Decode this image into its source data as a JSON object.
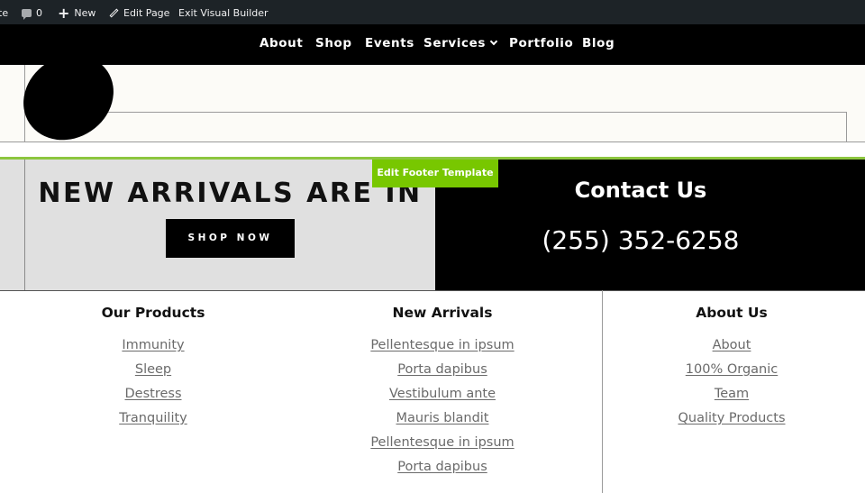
{
  "admin_bar": {
    "site_fragment": "te",
    "comments_count": "0",
    "new_label": "New",
    "edit_page_label": "Edit Page",
    "exit_builder_label": "Exit Visual Builder"
  },
  "nav": {
    "items": [
      "About",
      "Shop",
      "Events",
      "Services",
      "Portfolio",
      "Blog"
    ]
  },
  "builder": {
    "edit_footer_label": "Edit Footer Template"
  },
  "promo": {
    "title": "NEW ARRIVALS ARE IN",
    "button_label": "SHOP NOW"
  },
  "contact": {
    "title": "Contact Us",
    "phone": "(255) 352-6258"
  },
  "footer": {
    "columns": [
      {
        "title": "Our Products",
        "links": [
          "Immunity",
          "Sleep",
          "Destress",
          "Tranquility"
        ]
      },
      {
        "title": "New Arrivals",
        "links": [
          "Pellentesque in ipsum",
          "Porta dapibus",
          "Vestibulum ante",
          "Mauris blandit",
          "Pellentesque in ipsum",
          "Porta dapibus"
        ]
      },
      {
        "title": "About Us",
        "links": [
          "About",
          "100% Organic",
          "Team",
          "Quality Products"
        ]
      }
    ]
  },
  "colors": {
    "admin_bar_bg": "#1d2327",
    "nav_bg": "#000000",
    "accent_green": "#8cc63f",
    "promo_left_bg": "#e0e0e0",
    "promo_right_bg": "#000000",
    "link_color": "#6a6a6a"
  }
}
